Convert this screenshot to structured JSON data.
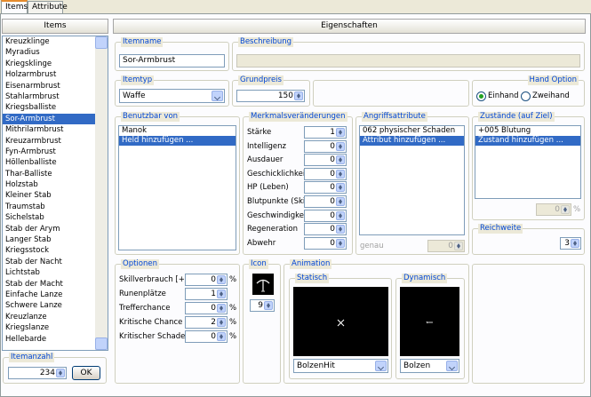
{
  "tabs": [
    "Items",
    "Attribute"
  ],
  "left": {
    "header": "Items",
    "items": [
      "Kreuzklinge",
      "Myradius",
      "Kriegsklinge",
      "Holzarmbrust",
      "Eisenarmbrust",
      "Stahlarmbrust",
      "Kriegsballiste",
      "Sor-Armbrust",
      "Mithrilarmbrust",
      "Kreuzarmbrust",
      "Fyn-Armbrust",
      "Höllenballiste",
      "Thar-Balliste",
      "Holzstab",
      "Kleiner Stab",
      "Traumstab",
      "Sichelstab",
      "Stab der Arym",
      "Langer Stab",
      "Kriegsstock",
      "Stab der Nacht",
      "Lichtstab",
      "Stab der Macht",
      "Einfache Lanze",
      "Schwere Lanze",
      "Kreuzlanze",
      "Kriegslanze",
      "Hellebarde"
    ],
    "selected_index": 7,
    "count_label": "Itemanzahl",
    "count_value": "234",
    "ok_label": "OK"
  },
  "right": {
    "header": "Eigenschaften",
    "itemname": {
      "label": "Itemname",
      "value": "Sor-Armbrust"
    },
    "beschreibung": {
      "label": "Beschreibung",
      "value": ""
    },
    "itemtyp": {
      "label": "Itemtyp",
      "value": "Waffe"
    },
    "grundpreis": {
      "label": "Grundpreis",
      "value": "150"
    },
    "hand": {
      "label": "Hand Option",
      "opt1": "Einhand",
      "opt2": "Zweihand",
      "selected": "Einhand"
    },
    "benutzbar": {
      "label": "Benutzbar von",
      "items": [
        "Manok",
        "Held hinzufügen ..."
      ],
      "selected_index": 1
    },
    "merkmals": {
      "label": "Merkmalsveränderungen",
      "rows": [
        {
          "name": "Stärke",
          "value": "1"
        },
        {
          "name": "Intelligenz",
          "value": "0"
        },
        {
          "name": "Ausdauer",
          "value": "0"
        },
        {
          "name": "Geschicklichkeit",
          "value": "0"
        },
        {
          "name": "HP (Leben)",
          "value": "0"
        },
        {
          "name": "Blutpunkte (Skill)",
          "value": "0"
        },
        {
          "name": "Geschwindigkeit",
          "value": "0"
        },
        {
          "name": "Regeneration",
          "value": "0"
        },
        {
          "name": "Abwehr",
          "value": "0"
        }
      ]
    },
    "angriff": {
      "label": "Angriffsattribute",
      "items": [
        "062 physischer Schaden",
        "Attribut hinzufügen ..."
      ],
      "selected_index": 1,
      "genau_label": "genau",
      "genau_value": "0"
    },
    "zustaende": {
      "label": "Zustände (auf Ziel)",
      "items": [
        "+005 Blutung",
        "Zustand hinzufügen ..."
      ],
      "selected_index": 1,
      "pct_value": "0",
      "pct_unit": "%"
    },
    "reichweite": {
      "label": "Reichweite",
      "value": "3"
    },
    "optionen": {
      "label": "Optionen",
      "rows": [
        {
          "name": "Skillverbrauch [+/-]",
          "value": "0",
          "unit": "%"
        },
        {
          "name": "Runenplätze",
          "value": "1",
          "unit": ""
        },
        {
          "name": "Trefferchance",
          "value": "0",
          "unit": "%"
        },
        {
          "name": "Kritische Chance",
          "value": "2",
          "unit": "%"
        },
        {
          "name": "Kritischer Schaden",
          "value": "0",
          "unit": "%"
        }
      ]
    },
    "icon": {
      "label": "Icon",
      "value": "9"
    },
    "animation": {
      "label": "Animation",
      "statisch": {
        "label": "Statisch",
        "value": "BolzenHit"
      },
      "dynamisch": {
        "label": "Dynamisch",
        "value": "Bolzen"
      }
    }
  }
}
